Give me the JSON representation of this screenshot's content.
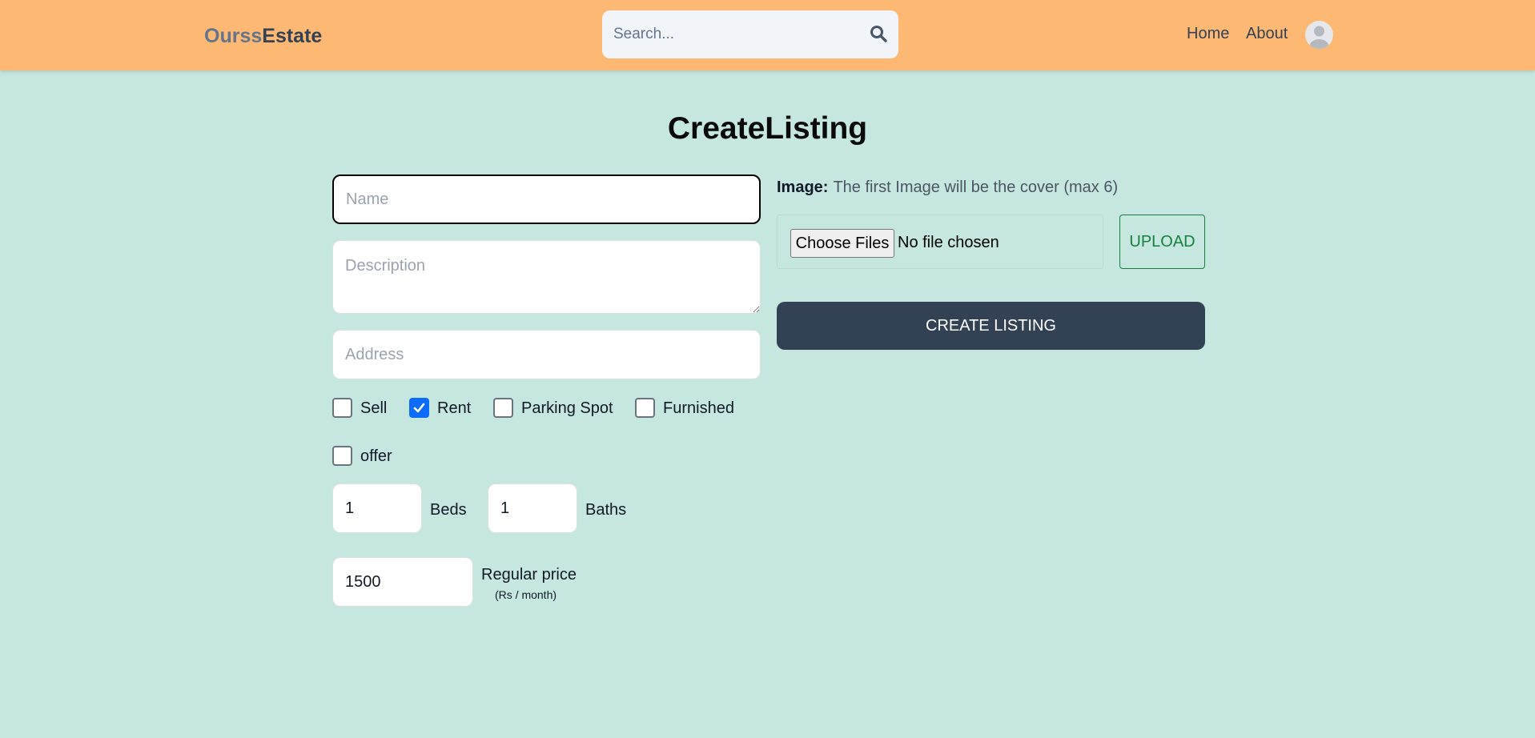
{
  "header": {
    "logo_part1": "Ourss",
    "logo_part2": "Estate",
    "search_placeholder": "Search...",
    "nav": {
      "home": "Home",
      "about": "About"
    },
    "background_color": "#fdb974"
  },
  "page": {
    "title": "CreateListing",
    "background_color": "#c6e7df"
  },
  "form": {
    "name_placeholder": "Name",
    "description_placeholder": "Description",
    "address_placeholder": "Address",
    "checkboxes": [
      {
        "label": "Sell",
        "checked": false
      },
      {
        "label": "Rent",
        "checked": true
      },
      {
        "label": "Parking Spot",
        "checked": false
      },
      {
        "label": "Furnished",
        "checked": false
      },
      {
        "label": "offer",
        "checked": false
      }
    ],
    "beds": {
      "value": "1",
      "label": "Beds"
    },
    "baths": {
      "value": "1",
      "label": "Baths"
    },
    "regular_price": {
      "value": "1500",
      "label": "Regular price",
      "unit": "(Rs / month)"
    }
  },
  "images": {
    "label": "Image:",
    "hint": "The first Image will be the cover (max 6)",
    "choose_label": "Choose Files",
    "no_file": "No file chosen",
    "upload_label": "UPLOAD"
  },
  "submit_label": "CREATE LISTING",
  "accent_colors": {
    "primary": "#334155",
    "upload": "#15803d",
    "checkbox": "#0b6cfb"
  }
}
